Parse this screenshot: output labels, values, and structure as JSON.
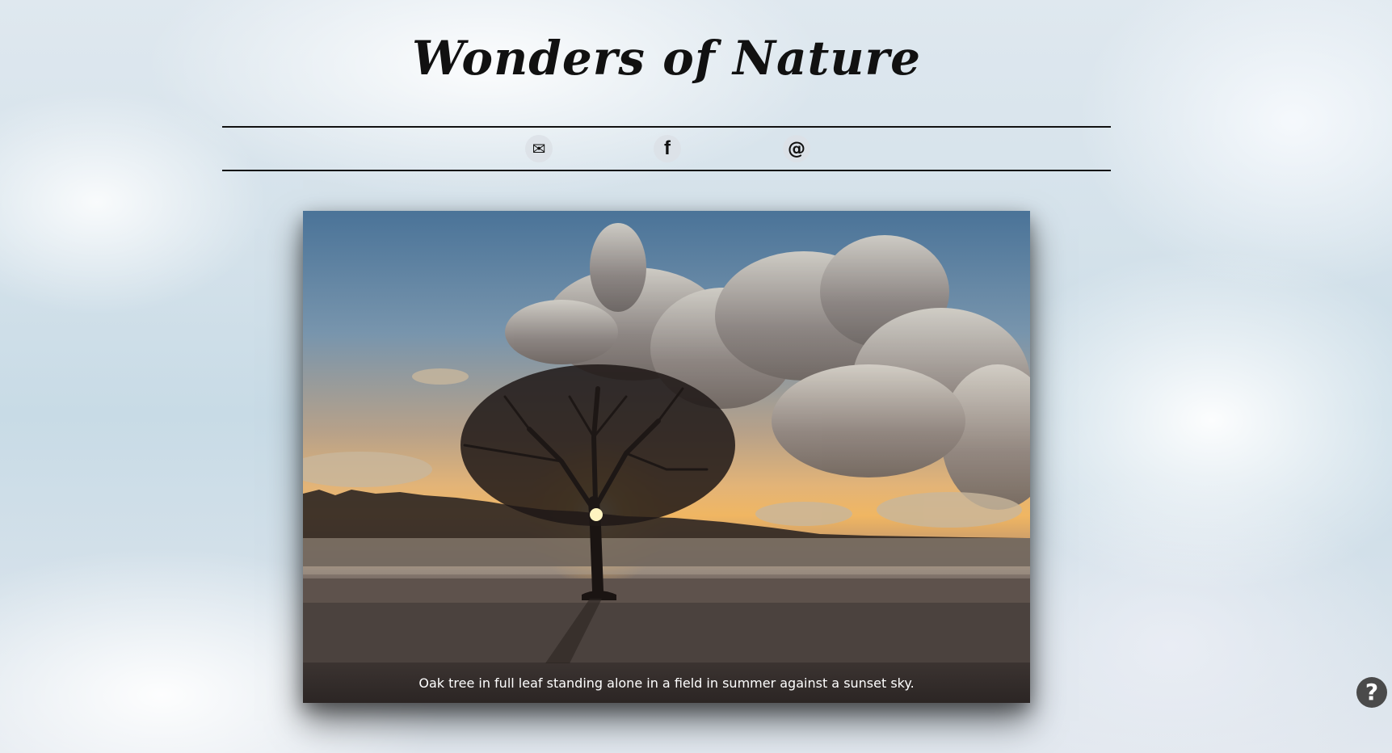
{
  "header": {
    "title": "Wonders of Nature"
  },
  "nav": {
    "icons": [
      {
        "name": "mail-icon",
        "glyph": "✉"
      },
      {
        "name": "facebook-icon",
        "glyph": "f"
      },
      {
        "name": "at-sign-icon",
        "glyph": "@"
      }
    ]
  },
  "photo": {
    "caption": "Oak tree in full leaf standing alone in a field in summer against a sunset sky."
  },
  "help": {
    "glyph": "?"
  },
  "colors": {
    "title": "#111111",
    "rule": "#111111",
    "help_bg": "#4a4a4a"
  }
}
